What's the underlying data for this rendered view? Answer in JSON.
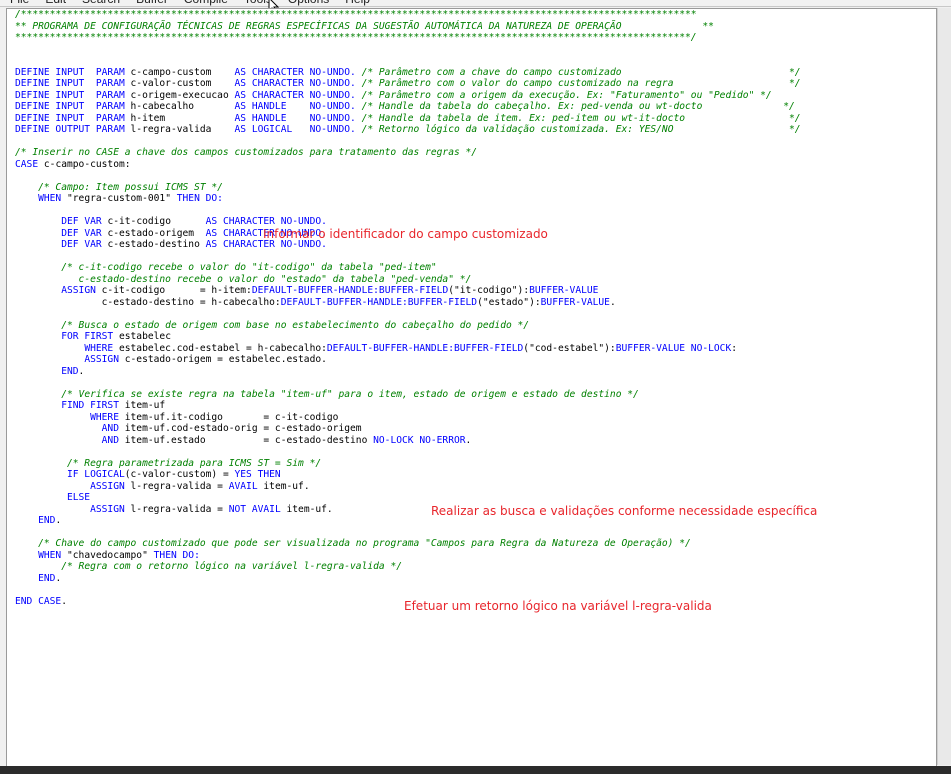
{
  "menu": [
    "File",
    "Edit",
    "Search",
    "Buffer",
    "Compile",
    "Tools",
    "Options",
    "Help"
  ],
  "code_lines": [
    [
      [
        "c",
        "/*********************************************************************************************************************"
      ]
    ],
    [
      [
        "c",
        "** PROGRAMA DE CONFIGURAÇÃO TÉCNICAS DE REGRAS ESPECÍFICAS DA SUGESTÃO AUTOMÁTICA DA NATUREZA DE OPERAÇÃO              **"
      ]
    ],
    [
      [
        "c",
        "*********************************************************************************************************************/"
      ]
    ],
    [],
    [],
    [
      [
        "k",
        "DEFINE INPUT  PARAM "
      ],
      [
        "s",
        "c-campo-custom    "
      ],
      [
        "k",
        "AS CHARACTER NO-UNDO. "
      ],
      [
        "c",
        "/* Parâmetro com a chave do campo customizado                             */"
      ]
    ],
    [
      [
        "k",
        "DEFINE INPUT  PARAM "
      ],
      [
        "s",
        "c-valor-custom    "
      ],
      [
        "k",
        "AS CHARACTER NO-UNDO. "
      ],
      [
        "c",
        "/* Parâmetro com o valor do campo customizado na regra                    */"
      ]
    ],
    [
      [
        "k",
        "DEFINE INPUT  PARAM "
      ],
      [
        "s",
        "c-origem-execucao "
      ],
      [
        "k",
        "AS CHARACTER NO-UNDO. "
      ],
      [
        "c",
        "/* Parâmetro com a origem da execução. Ex: \"Faturamento\" ou \"Pedido\" */"
      ]
    ],
    [
      [
        "k",
        "DEFINE INPUT  PARAM "
      ],
      [
        "s",
        "h-cabecalho       "
      ],
      [
        "k",
        "AS HANDLE    NO-UNDO. "
      ],
      [
        "c",
        "/* Handle da tabela do cabeçalho. Ex: ped-venda ou wt-docto              */"
      ]
    ],
    [
      [
        "k",
        "DEFINE INPUT  PARAM "
      ],
      [
        "s",
        "h-item            "
      ],
      [
        "k",
        "AS HANDLE    NO-UNDO. "
      ],
      [
        "c",
        "/* Handle da tabela de item. Ex: ped-item ou wt-it-docto                  */"
      ]
    ],
    [
      [
        "k",
        "DEFINE OUTPUT PARAM "
      ],
      [
        "s",
        "l-regra-valida    "
      ],
      [
        "k",
        "AS LOGICAL   NO-UNDO. "
      ],
      [
        "c",
        "/* Retorno lógico da validação customizada. Ex: YES/NO                    */"
      ]
    ],
    [],
    [
      [
        "c",
        "/* Inserir no CASE a chave dos campos customizados para tratamento das regras */"
      ]
    ],
    [
      [
        "k",
        "CASE "
      ],
      [
        "s",
        "c-campo-custom:"
      ]
    ],
    [],
    [
      [
        "s",
        "    "
      ],
      [
        "c",
        "/* Campo: Item possui ICMS ST */"
      ]
    ],
    [
      [
        "s",
        "    "
      ],
      [
        "k",
        "WHEN "
      ],
      [
        "s",
        "\"regra-custom-001\" "
      ],
      [
        "k",
        "THEN DO:"
      ]
    ],
    [],
    [
      [
        "s",
        "        "
      ],
      [
        "k",
        "DEF VAR "
      ],
      [
        "s",
        "c-it-codigo      "
      ],
      [
        "k",
        "AS CHARACTER NO-UNDO."
      ]
    ],
    [
      [
        "s",
        "        "
      ],
      [
        "k",
        "DEF VAR "
      ],
      [
        "s",
        "c-estado-origem  "
      ],
      [
        "k",
        "AS CHARACTER NO-UNDO."
      ]
    ],
    [
      [
        "s",
        "        "
      ],
      [
        "k",
        "DEF VAR "
      ],
      [
        "s",
        "c-estado-destino "
      ],
      [
        "k",
        "AS CHARACTER NO-UNDO."
      ]
    ],
    [],
    [
      [
        "s",
        "        "
      ],
      [
        "c",
        "/* c-it-codigo recebe o valor do \"it-codigo\" da tabela \"ped-item\""
      ]
    ],
    [
      [
        "s",
        "        "
      ],
      [
        "c",
        "   c-estado-destino recebe o valor do \"estado\" da tabela \"ped-venda\" */"
      ]
    ],
    [
      [
        "s",
        "        "
      ],
      [
        "k",
        "ASSIGN "
      ],
      [
        "s",
        "c-it-codigo      = h-item:"
      ],
      [
        "k",
        "DEFAULT-BUFFER-HANDLE:BUFFER-FIELD"
      ],
      [
        "s",
        "(\"it-codigo\"):"
      ],
      [
        "k",
        "BUFFER-VALUE"
      ]
    ],
    [
      [
        "s",
        "               c-estado-destino = h-cabecalho:"
      ],
      [
        "k",
        "DEFAULT-BUFFER-HANDLE:BUFFER-FIELD"
      ],
      [
        "s",
        "(\"estado\"):"
      ],
      [
        "k",
        "BUFFER-VALUE"
      ],
      [
        "s",
        "."
      ]
    ],
    [],
    [
      [
        "s",
        "        "
      ],
      [
        "c",
        "/* Busca o estado de origem com base no estabelecimento do cabeçalho do pedido */"
      ]
    ],
    [
      [
        "s",
        "        "
      ],
      [
        "k",
        "FOR FIRST "
      ],
      [
        "s",
        "estabelec"
      ]
    ],
    [
      [
        "s",
        "            "
      ],
      [
        "k",
        "WHERE "
      ],
      [
        "s",
        "estabelec.cod-estabel = h-cabecalho:"
      ],
      [
        "k",
        "DEFAULT-BUFFER-HANDLE:BUFFER-FIELD"
      ],
      [
        "s",
        "(\"cod-estabel\"):"
      ],
      [
        "k",
        "BUFFER-VALUE NO-LOCK"
      ],
      [
        "s",
        ":"
      ]
    ],
    [
      [
        "s",
        "            "
      ],
      [
        "k",
        "ASSIGN "
      ],
      [
        "s",
        "c-estado-origem = estabelec.estado."
      ]
    ],
    [
      [
        "s",
        "        "
      ],
      [
        "k",
        "END"
      ],
      [
        "s",
        "."
      ]
    ],
    [],
    [
      [
        "s",
        "        "
      ],
      [
        "c",
        "/* Verifica se existe regra na tabela \"item-uf\" para o item, estado de origem e estado de destino */"
      ]
    ],
    [
      [
        "s",
        "        "
      ],
      [
        "k",
        "FIND FIRST "
      ],
      [
        "s",
        "item-uf"
      ]
    ],
    [
      [
        "s",
        "             "
      ],
      [
        "k",
        "WHERE "
      ],
      [
        "s",
        "item-uf.it-codigo       = c-it-codigo"
      ]
    ],
    [
      [
        "s",
        "               "
      ],
      [
        "k",
        "AND "
      ],
      [
        "s",
        "item-uf.cod-estado-orig = c-estado-origem"
      ]
    ],
    [
      [
        "s",
        "               "
      ],
      [
        "k",
        "AND "
      ],
      [
        "s",
        "item-uf.estado          = c-estado-destino "
      ],
      [
        "k",
        "NO-LOCK NO-ERROR"
      ],
      [
        "s",
        "."
      ]
    ],
    [],
    [
      [
        "s",
        "         "
      ],
      [
        "c",
        "/* Regra parametrizada para ICMS ST = Sim */"
      ]
    ],
    [
      [
        "s",
        "         "
      ],
      [
        "k",
        "IF LOGICAL"
      ],
      [
        "s",
        "(c-valor-custom) = "
      ],
      [
        "k",
        "YES THEN"
      ]
    ],
    [
      [
        "s",
        "             "
      ],
      [
        "k",
        "ASSIGN "
      ],
      [
        "s",
        "l-regra-valida = "
      ],
      [
        "k",
        "AVAIL "
      ],
      [
        "s",
        "item-uf."
      ]
    ],
    [
      [
        "s",
        "         "
      ],
      [
        "k",
        "ELSE"
      ]
    ],
    [
      [
        "s",
        "             "
      ],
      [
        "k",
        "ASSIGN "
      ],
      [
        "s",
        "l-regra-valida = "
      ],
      [
        "k",
        "NOT AVAIL "
      ],
      [
        "s",
        "item-uf."
      ]
    ],
    [
      [
        "s",
        "    "
      ],
      [
        "k",
        "END"
      ],
      [
        "s",
        "."
      ]
    ],
    [],
    [
      [
        "s",
        "    "
      ],
      [
        "c",
        "/* Chave do campo customizado que pode ser visualizada no programa \"Campos para Regra da Natureza de Operação) */"
      ]
    ],
    [
      [
        "s",
        "    "
      ],
      [
        "k",
        "WHEN "
      ],
      [
        "s",
        "\"chavedocampo\" "
      ],
      [
        "k",
        "THEN DO:"
      ]
    ],
    [
      [
        "s",
        "        "
      ],
      [
        "c",
        "/* Regra com o retorno lógico na variável l-regra-valida */"
      ]
    ],
    [
      [
        "s",
        "    "
      ],
      [
        "k",
        "END"
      ],
      [
        "s",
        "."
      ]
    ],
    [],
    [
      [
        "k",
        "END CASE"
      ],
      [
        "s",
        "."
      ]
    ]
  ],
  "annotations": {
    "field_identifier": "Informar o identificador do campo customizado",
    "search_validations": "Realizar as busca e validações conforme necessidade específica",
    "logical_return": "Efetuar um retorno lógico na variável l-regra-valida"
  }
}
